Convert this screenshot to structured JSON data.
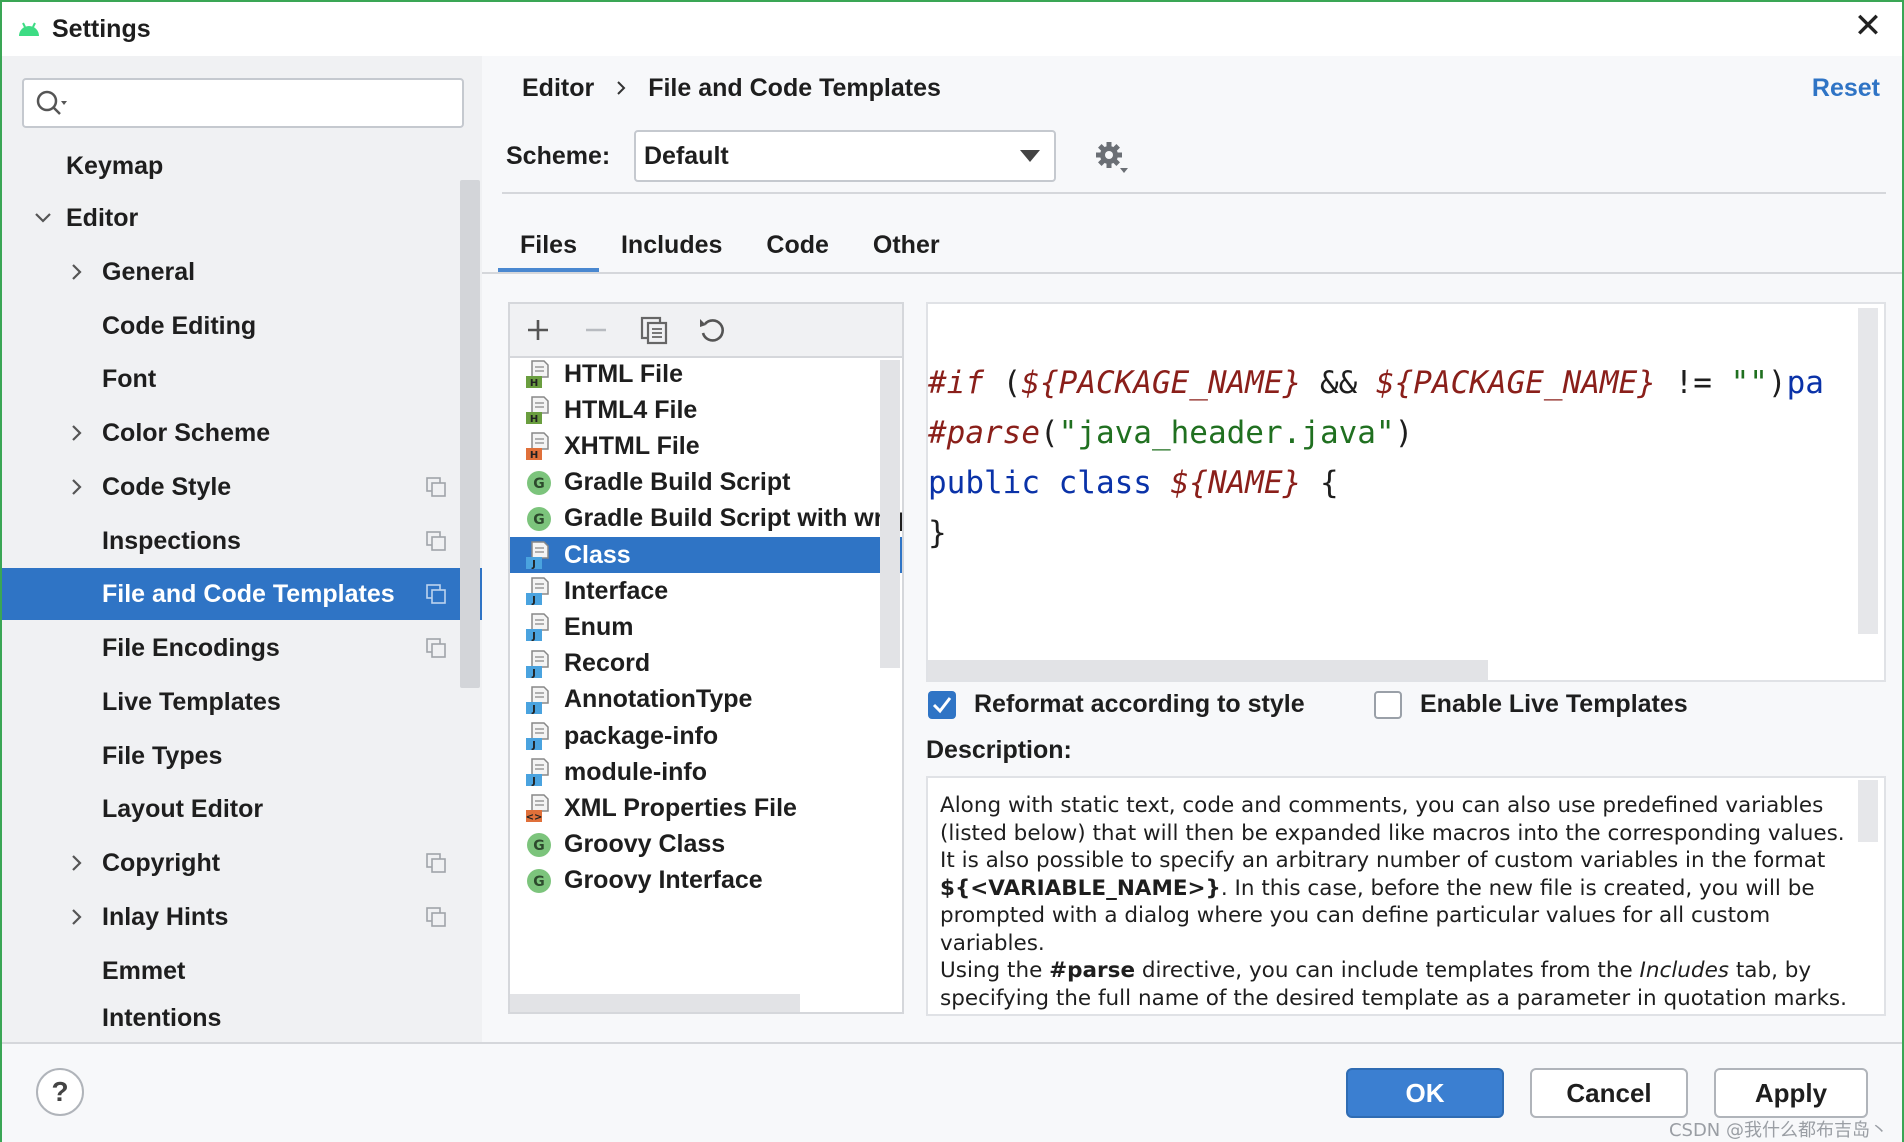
{
  "window": {
    "title": "Settings",
    "close_label": "✕"
  },
  "sidebar": {
    "search_placeholder": "",
    "items": [
      {
        "label": "Keymap"
      },
      {
        "label": "Editor"
      },
      {
        "label": "General"
      },
      {
        "label": "Code Editing"
      },
      {
        "label": "Font"
      },
      {
        "label": "Color Scheme"
      },
      {
        "label": "Code Style"
      },
      {
        "label": "Inspections"
      },
      {
        "label": "File and Code Templates"
      },
      {
        "label": "File Encodings"
      },
      {
        "label": "Live Templates"
      },
      {
        "label": "File Types"
      },
      {
        "label": "Layout Editor"
      },
      {
        "label": "Copyright"
      },
      {
        "label": "Inlay Hints"
      },
      {
        "label": "Emmet"
      },
      {
        "label": "Intentions"
      }
    ]
  },
  "header": {
    "breadcrumb": [
      "Editor",
      "File and Code Templates"
    ],
    "reset_label": "Reset",
    "scheme_label": "Scheme:",
    "scheme_value": "Default"
  },
  "tabs": [
    {
      "label": "Files",
      "active": true
    },
    {
      "label": "Includes",
      "active": false
    },
    {
      "label": "Code",
      "active": false
    },
    {
      "label": "Other",
      "active": false
    }
  ],
  "templates": [
    {
      "label": "HTML File",
      "icon": "html-file-icon",
      "badge": "H",
      "badge_color": "#6a9e3f"
    },
    {
      "label": "HTML4 File",
      "icon": "html-file-icon",
      "badge": "H",
      "badge_color": "#6a9e3f"
    },
    {
      "label": "XHTML File",
      "icon": "xhtml-file-icon",
      "badge": "H",
      "badge_color": "#e0703a"
    },
    {
      "label": "Gradle Build Script",
      "icon": "gradle-icon",
      "badge": "G",
      "badge_color": "#7cc47c"
    },
    {
      "label": "Gradle Build Script with wrapper",
      "icon": "gradle-icon",
      "badge": "G",
      "badge_color": "#7cc47c"
    },
    {
      "label": "Class",
      "icon": "java-file-icon",
      "badge": "J",
      "badge_color": "#4aa3df"
    },
    {
      "label": "Interface",
      "icon": "java-file-icon",
      "badge": "J",
      "badge_color": "#4aa3df"
    },
    {
      "label": "Enum",
      "icon": "java-file-icon",
      "badge": "J",
      "badge_color": "#4aa3df"
    },
    {
      "label": "Record",
      "icon": "java-file-icon",
      "badge": "J",
      "badge_color": "#4aa3df"
    },
    {
      "label": "AnnotationType",
      "icon": "java-file-icon",
      "badge": "J",
      "badge_color": "#4aa3df"
    },
    {
      "label": "package-info",
      "icon": "java-file-icon",
      "badge": "J",
      "badge_color": "#4aa3df"
    },
    {
      "label": "module-info",
      "icon": "java-file-icon",
      "badge": "J",
      "badge_color": "#4aa3df"
    },
    {
      "label": "XML Properties File",
      "icon": "xml-file-icon",
      "badge": "<>",
      "badge_color": "#e0703a"
    },
    {
      "label": "Groovy Class",
      "icon": "groovy-icon",
      "badge": "G",
      "badge_color": "#7cc47c"
    },
    {
      "label": "Groovy Interface",
      "icon": "groovy-icon",
      "badge": "G",
      "badge_color": "#7cc47c"
    }
  ],
  "editor": {
    "line1_kw": "#if",
    "line1_a": " (",
    "line1_v1": "${PACKAGE_NAME}",
    "line1_b": " && ",
    "line1_v2": "${PACKAGE_NAME}",
    "line1_c": " != ",
    "line1_str": "\"\"",
    "line1_d": ")",
    "line1_e": "pa",
    "line2_kw": "#parse",
    "line2_a": "(",
    "line2_str": "\"java_header.java\"",
    "line2_b": ")",
    "line3_kw": "public class",
    "line3_sp": " ",
    "line3_var": "${NAME}",
    "line3_b": " {",
    "line4": "}"
  },
  "options": {
    "reformat_label": "Reformat according to style",
    "reformat_checked": true,
    "live_templates_label": "Enable Live Templates",
    "live_templates_checked": false
  },
  "description": {
    "label": "Description:",
    "p1": "Along with static text, code and comments, you can also use predefined variables (listed below) that will then be expanded like macros into the corresponding values.",
    "p2a": "It is also possible to specify an arbitrary number of custom variables in the format ",
    "p2b": "${<VARIABLE_NAME>}",
    "p2c": ". In this case, before the new file is created, you will be prompted with a dialog where you can define particular values for all custom variables.",
    "p3a": "Using the ",
    "p3b": "#parse",
    "p3c": " directive, you can include templates from the ",
    "p3d": "Includes",
    "p3e": " tab, by specifying the full name of the desired template as a parameter in quotation marks."
  },
  "footer": {
    "help_label": "?",
    "ok_label": "OK",
    "cancel_label": "Cancel",
    "apply_label": "Apply",
    "watermark": "CSDN @我什么都布吉岛丶"
  },
  "colors": {
    "accent": "#2f74c5",
    "window_border": "#3aa655"
  }
}
